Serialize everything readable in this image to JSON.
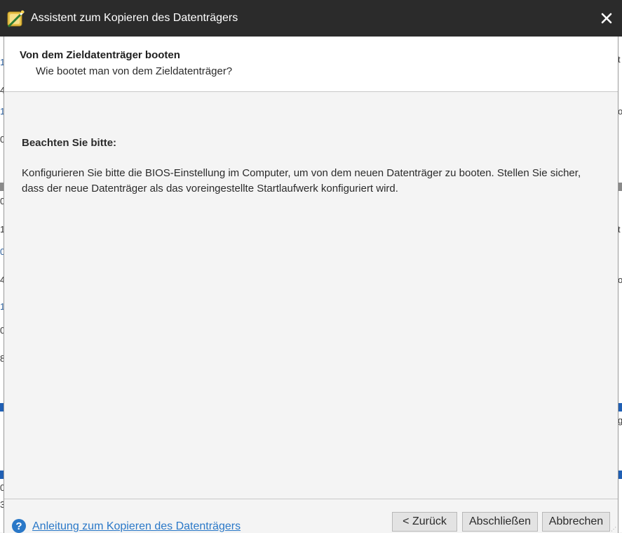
{
  "window": {
    "title": "Assistent zum Kopieren des Datenträgers",
    "close_glyph": "✕"
  },
  "header": {
    "title": "Von dem Zieldatenträger booten",
    "subtitle": "Wie bootet man von dem Zieldatenträger?"
  },
  "content": {
    "heading": "Beachten Sie bitte:",
    "body": "Konfigurieren Sie bitte die BIOS-Einstellung im Computer, um von dem neuen Datenträger zu booten. Stellen Sie sicher, dass der neue Datenträger als das voreingestellte Startlaufwerk konfiguriert wird."
  },
  "footer": {
    "help_glyph": "?",
    "help_link": "Anleitung zum Kopieren des Datenträgers",
    "buttons": {
      "back": "< Zurück",
      "finish": "Abschließen",
      "cancel": "Abbrechen"
    }
  },
  "background_app": {
    "left_glyphs": [
      "1",
      "4",
      "1",
      "0",
      "0",
      "1",
      "0",
      "1",
      "4",
      "1",
      "0",
      "8",
      "0",
      "3"
    ],
    "right_glyphs": [
      "t",
      "o",
      "c",
      "t",
      "o",
      "g"
    ]
  },
  "colors": {
    "titlebar": "#2b2b2b",
    "link": "#2a78c8",
    "accent_blue": "#1f5fb4"
  }
}
